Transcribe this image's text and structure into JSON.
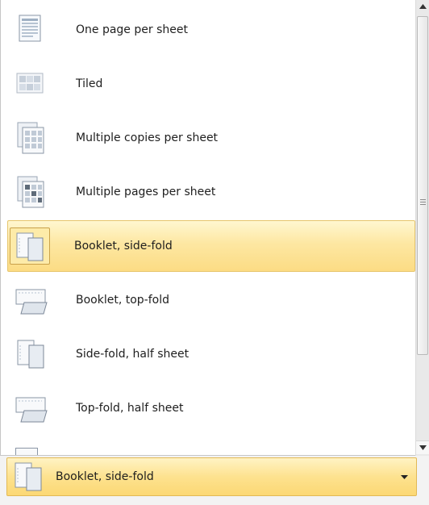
{
  "menu": {
    "items": [
      {
        "label": "One page per sheet",
        "icon": "one-page-per-sheet-icon"
      },
      {
        "label": "Tiled",
        "icon": "tiled-icon"
      },
      {
        "label": "Multiple copies per sheet",
        "icon": "multiple-copies-icon"
      },
      {
        "label": "Multiple pages per sheet",
        "icon": "multiple-pages-icon"
      },
      {
        "label": "Booklet, side-fold",
        "icon": "booklet-side-fold-icon",
        "selected": true
      },
      {
        "label": "Booklet, top-fold",
        "icon": "booklet-top-fold-icon"
      },
      {
        "label": "Side-fold, half sheet",
        "icon": "side-fold-half-sheet-icon"
      },
      {
        "label": "Top-fold, half sheet",
        "icon": "top-fold-half-sheet-icon"
      }
    ]
  },
  "combo": {
    "value": "Booklet, side-fold",
    "icon": "booklet-side-fold-icon"
  },
  "colors": {
    "highlight": "#fde7a2",
    "highlight_border": "#e6c56c"
  }
}
